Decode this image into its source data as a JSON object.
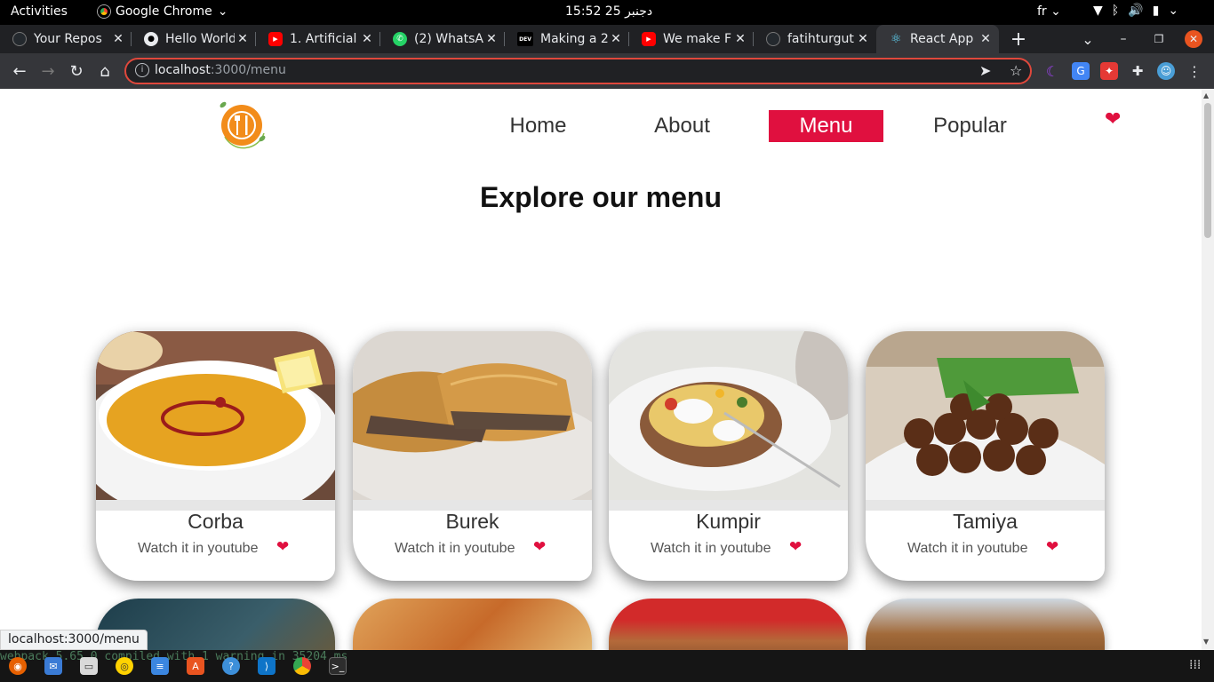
{
  "system_bar": {
    "activities": "Activities",
    "app_name": "Google Chrome",
    "clock": "15:52  25 دجنبر",
    "language": "fr"
  },
  "tabs": [
    {
      "title": "Your Repos",
      "icon": "github-icon",
      "color": "#24292e"
    },
    {
      "title": "Hello World",
      "icon": "github-icon",
      "color": "#24292e"
    },
    {
      "title": "1. Artificial",
      "icon": "youtube-icon",
      "color": "#ff0000"
    },
    {
      "title": "(2) WhatsA",
      "icon": "whatsapp-icon",
      "color": "#25d366"
    },
    {
      "title": "Making a 2",
      "icon": "dev-icon",
      "color": "#000000"
    },
    {
      "title": "We make F",
      "icon": "youtube-icon",
      "color": "#ff0000"
    },
    {
      "title": "fatihturgut",
      "icon": "github-icon",
      "color": "#24292e"
    },
    {
      "title": "React App",
      "icon": "react-icon",
      "color": "#61dafb",
      "active": true
    }
  ],
  "address_bar": {
    "host": "localhost",
    "path": ":3000/menu"
  },
  "status_url": "localhost:3000/menu",
  "terminal_text": "webpack 5.65.0 compiled with 1 warning in 35204 ms",
  "site": {
    "nav": {
      "home": "Home",
      "about": "About",
      "menu": "Menu",
      "popular": "Popular",
      "active": "Menu"
    },
    "page_title": "Explore our menu",
    "brand_color": "#e0103f",
    "dishes": [
      {
        "name": "Corba",
        "link": "Watch it in youtube"
      },
      {
        "name": "Burek",
        "link": "Watch it in youtube"
      },
      {
        "name": "Kumpir",
        "link": "Watch it in youtube"
      },
      {
        "name": "Tamiya",
        "link": "Watch it in youtube"
      }
    ]
  }
}
